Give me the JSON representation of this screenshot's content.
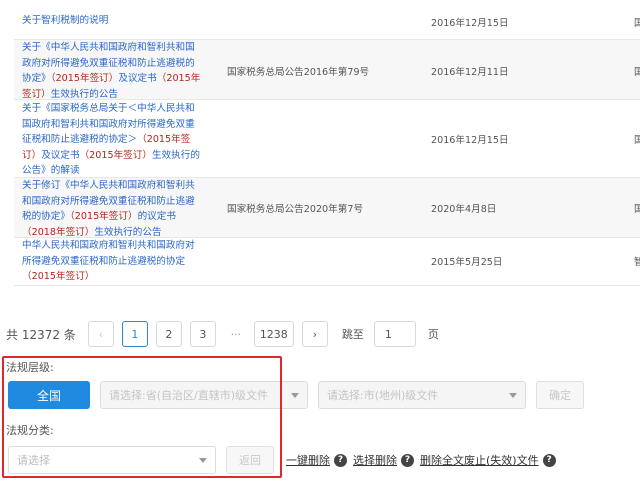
{
  "table": {
    "rows": [
      {
        "title": [
          {
            "t": "关于智利税制的说明",
            "c": "blue"
          }
        ],
        "doc": "",
        "date": "2016年12月15日",
        "edge": "国"
      },
      {
        "title": [
          {
            "t": "关于《中华人民共和国政府和智利共和国政府对所得避免双重征税和防止逃避税的协定》",
            "c": "blue"
          },
          {
            "t": "（2015年签订）",
            "c": "red"
          },
          {
            "t": "及议定书",
            "c": "blue"
          },
          {
            "t": "（2015年签订）",
            "c": "red"
          },
          {
            "t": "生效执行的公告",
            "c": "blue"
          }
        ],
        "doc": "国家税务总局公告2016年第79号",
        "date": "2016年12月11日",
        "edge": "国"
      },
      {
        "title": [
          {
            "t": "关于《国家税务总局关于＜中华人民共和国政府和智利共和国政府对所得避免双重征税和防止逃避税的协定＞",
            "c": "blue"
          },
          {
            "t": "（2015年签订）",
            "c": "red"
          },
          {
            "t": "及议定书",
            "c": "blue"
          },
          {
            "t": "（2015年签订）",
            "c": "red"
          },
          {
            "t": "生效执行的公告》的解读",
            "c": "blue"
          }
        ],
        "doc": "",
        "date": "2016年12月15日",
        "edge": "国"
      },
      {
        "title": [
          {
            "t": "关于修订《中华人民共和国政府和智利共和国政府对所得避免双重征税和防止逃避税的协定》",
            "c": "blue"
          },
          {
            "t": "（2015年签订）",
            "c": "red"
          },
          {
            "t": "的议定书",
            "c": "blue"
          },
          {
            "t": "（2018年签订）",
            "c": "red"
          },
          {
            "t": "生效执行的公告",
            "c": "blue"
          }
        ],
        "doc": "国家税务总局公告2020年第7号",
        "date": "2020年4月8日",
        "edge": "国"
      },
      {
        "title": [
          {
            "t": "中华人民共和国政府和智利共和国政府对所得避免双重征税和防止逃避税的协定",
            "c": "blue"
          },
          {
            "t": "（2015年签订）",
            "c": "red"
          }
        ],
        "doc": "",
        "date": "2015年5月25日",
        "edge": "智"
      }
    ]
  },
  "pagination": {
    "total": "共 12372 条",
    "prev": "‹",
    "pages": [
      "1",
      "2",
      "3"
    ],
    "dots": "···",
    "last": "1238",
    "next": "›",
    "jump_label": "跳至",
    "jump_value": "1",
    "page_unit": "页"
  },
  "filter": {
    "level_label": "法规层级:",
    "national_button": "全国",
    "province_placeholder": "请选择:省(自治区/直辖市)级文件",
    "city_placeholder": "请选择:市(地州)级文件",
    "confirm_button": "确定",
    "category_label": "法规分类:",
    "category_placeholder": "请选择",
    "back_button": "返回"
  },
  "actions": {
    "clear_all": "一键删除",
    "clear_selected": "选择删除",
    "clear_repealed": "删除全文废止(失效)文件",
    "help_glyph": "?"
  },
  "colors": {
    "accent": "#1f8ae0",
    "link": "#2a67c9",
    "highlight": "#b3261e",
    "annotation": "#e0272b"
  }
}
